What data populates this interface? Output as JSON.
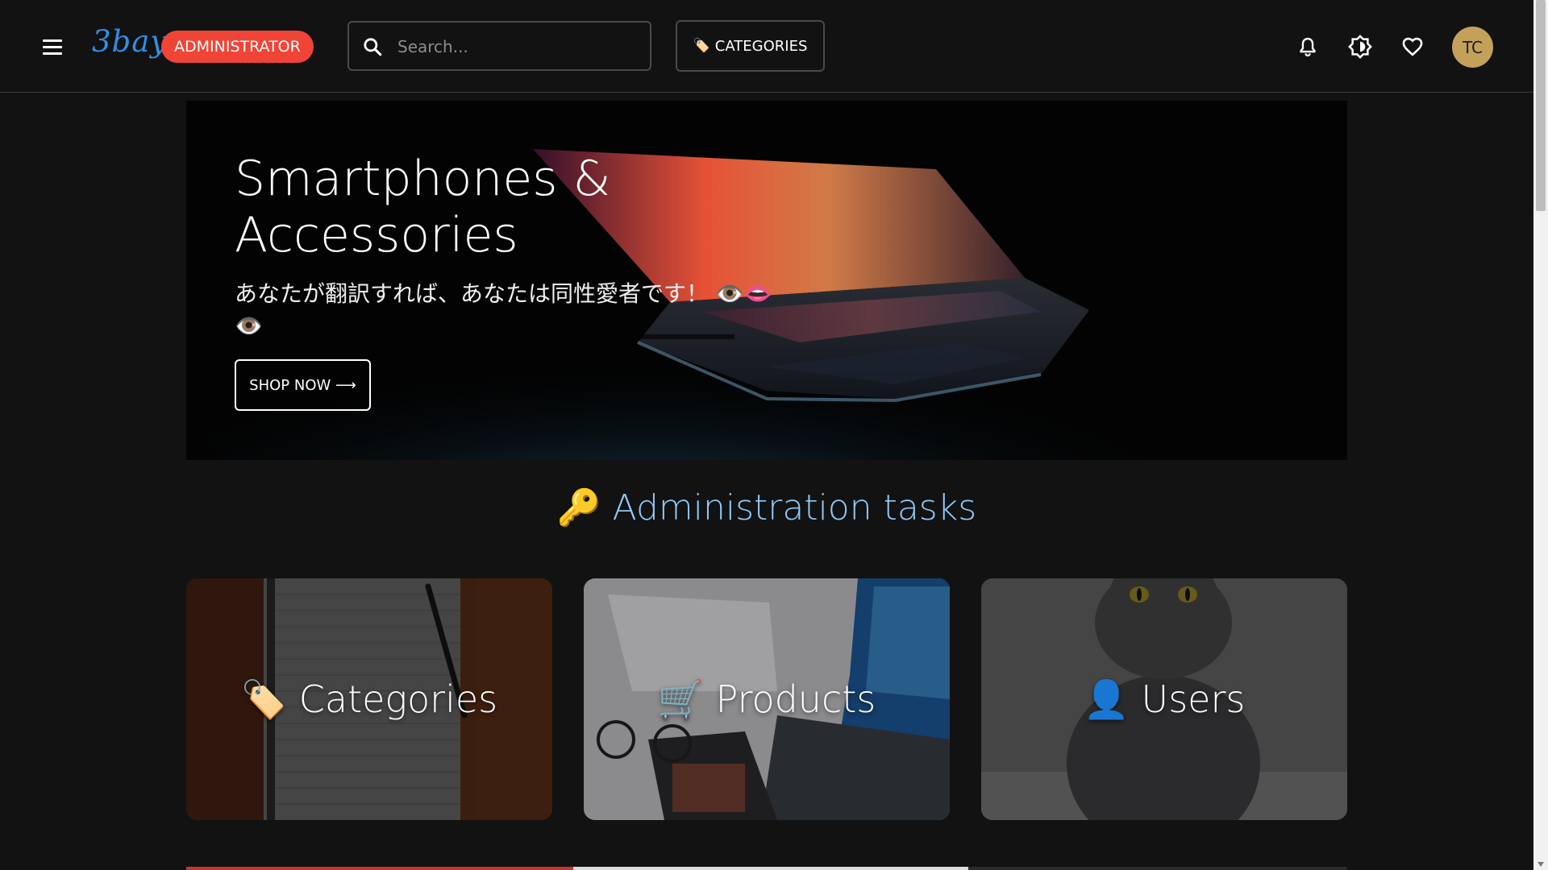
{
  "header": {
    "logo": "3bay",
    "role_badge": "ADMINISTRATOR",
    "search_placeholder": "Search...",
    "categories_button": "CATEGORIES",
    "categories_button_icon": "🏷️",
    "avatar_initials": "TC",
    "icons": [
      "menu-icon",
      "search-icon",
      "bell-icon",
      "brightness-icon",
      "heart-icon"
    ]
  },
  "hero": {
    "title": "Smartphones & Accessories",
    "subtitle": "あなたが翻訳すれば、あなたは同性愛者です！ 👁️👄👁️",
    "button_label": "SHOP NOW ⟶"
  },
  "admin": {
    "title": "🔑 Administration tasks",
    "cards": [
      {
        "label": "🏷️ Categories"
      },
      {
        "label": "🛒 Products"
      },
      {
        "label": "👤 Users"
      }
    ]
  },
  "colors": {
    "background": "#121212",
    "badge": "#f04437",
    "logo": "#2f8fe6",
    "section_title": "#90caf9",
    "avatar": "#c4a15a"
  }
}
